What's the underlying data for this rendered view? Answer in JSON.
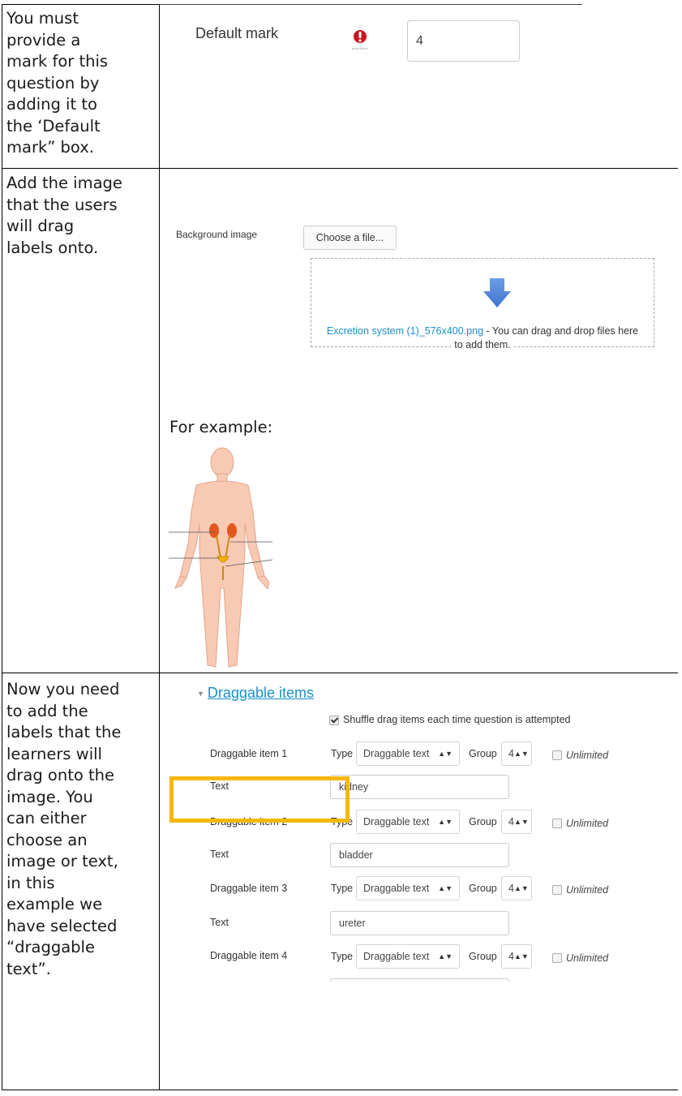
{
  "instructions": {
    "row1": [
      "You must",
      "provide a",
      "mark for this",
      "question by",
      "adding it to",
      "the ‘Default",
      "mark” box."
    ],
    "row2": [
      "Add the image",
      "that the users",
      "will drag",
      "labels onto."
    ],
    "row3": [
      "Now you need",
      "to add the",
      "labels that the",
      "learners will",
      "drag onto the",
      "image. You",
      "can either",
      "choose an",
      "image or text,",
      "in this",
      "example we",
      "have selected",
      "“draggable",
      "text”."
    ]
  },
  "default_mark": {
    "label": "Default mark",
    "value": "4",
    "required_icon": "exclamation-circle-icon",
    "icon_color": "#c9151c"
  },
  "background_image": {
    "label": "Background image",
    "choose_button": "Choose a file...",
    "file_link": "Excretion system (1)_576x400.png",
    "drop_text": " - You can drag and drop files here",
    "drop_text2": "to add them.",
    "arrow_icon": "download-arrow-icon",
    "link_color": "#1a8fc6"
  },
  "example": {
    "label": "For example:",
    "image_icon": "human-excretory-system-illustration"
  },
  "draggable_items": {
    "section_title": "Draggable items",
    "shuffle_label": "Shuffle drag items each time question is attempted",
    "type_label": "Type",
    "group_label": "Group",
    "unlimited_label": "Unlimited",
    "text_label": "Text",
    "highlight_color": "#f5b800",
    "items": [
      {
        "label": "Draggable item 1",
        "type": "Draggable text",
        "group": "4",
        "text": "kidney"
      },
      {
        "label": "Draggable item 2",
        "type": "Draggable text",
        "group": "4",
        "text": "bladder"
      },
      {
        "label": "Draggable item 3",
        "type": "Draggable text",
        "group": "4",
        "text": "ureter"
      },
      {
        "label": "Draggable item 4",
        "type": "Draggable text",
        "group": "4",
        "text": ""
      }
    ]
  }
}
